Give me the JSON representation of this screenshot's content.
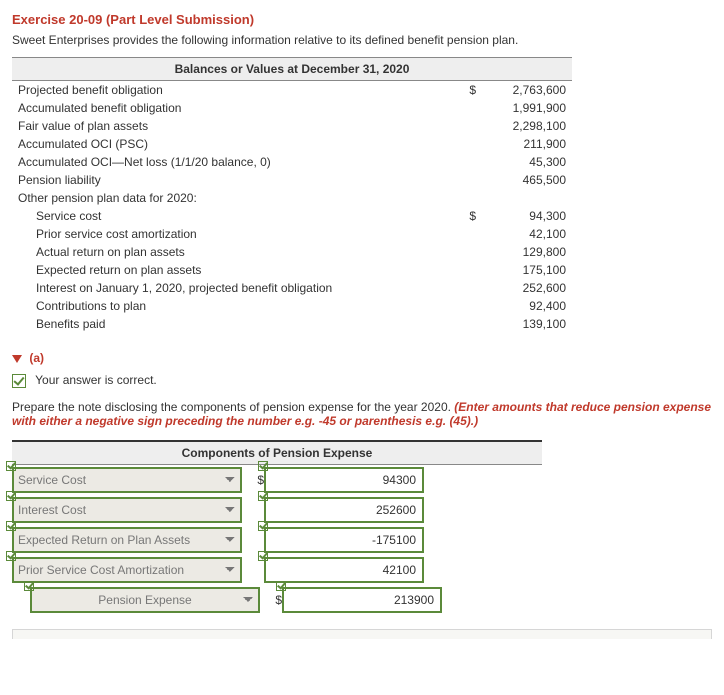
{
  "exercise": {
    "title": "Exercise 20-09 (Part Level Submission)",
    "intro": "Sweet Enterprises provides the following information relative to its defined benefit pension plan."
  },
  "balances": {
    "header": "Balances or Values at December 31, 2020",
    "rows": [
      {
        "label": "Projected benefit obligation",
        "currency": "$",
        "value": "2,763,600",
        "indent": false
      },
      {
        "label": "Accumulated benefit obligation",
        "currency": "",
        "value": "1,991,900",
        "indent": false
      },
      {
        "label": "Fair value of plan assets",
        "currency": "",
        "value": "2,298,100",
        "indent": false
      },
      {
        "label": "Accumulated OCI (PSC)",
        "currency": "",
        "value": "211,900",
        "indent": false
      },
      {
        "label": "Accumulated OCI—Net loss (1/1/20 balance, 0)",
        "currency": "",
        "value": "45,300",
        "indent": false
      },
      {
        "label": "Pension liability",
        "currency": "",
        "value": "465,500",
        "indent": false
      },
      {
        "label": "Other pension plan data for 2020:",
        "currency": "",
        "value": "",
        "indent": false
      },
      {
        "label": "Service cost",
        "currency": "$",
        "value": "94,300",
        "indent": true
      },
      {
        "label": "Prior service cost amortization",
        "currency": "",
        "value": "42,100",
        "indent": true
      },
      {
        "label": "Actual return on plan assets",
        "currency": "",
        "value": "129,800",
        "indent": true
      },
      {
        "label": "Expected return on plan assets",
        "currency": "",
        "value": "175,100",
        "indent": true
      },
      {
        "label": "Interest on January 1, 2020, projected benefit obligation",
        "currency": "",
        "value": "252,600",
        "indent": true
      },
      {
        "label": "Contributions to plan",
        "currency": "",
        "value": "92,400",
        "indent": true
      },
      {
        "label": "Benefits paid",
        "currency": "",
        "value": "139,100",
        "indent": true
      }
    ]
  },
  "part_a": {
    "label": "(a)",
    "correct_msg": "Your answer is correct.",
    "instruction_plain": "Prepare the note disclosing the components of pension expense for the year 2020. ",
    "instruction_red": "(Enter amounts that reduce pension expense with either a negative sign preceding the number e.g. -45 or parenthesis e.g. (45).)",
    "table_header": "Components of Pension Expense",
    "rows": [
      {
        "select": "Service Cost",
        "dollar": "$",
        "value": "94300",
        "total": false
      },
      {
        "select": "Interest Cost",
        "dollar": "",
        "value": "252600",
        "total": false
      },
      {
        "select": "Expected Return on Plan Assets",
        "dollar": "",
        "value": "-175100",
        "total": false
      },
      {
        "select": "Prior Service Cost Amortization",
        "dollar": "",
        "value": "42100",
        "total": false
      },
      {
        "select": "Pension Expense",
        "dollar": "$",
        "value": "213900",
        "total": true
      }
    ]
  }
}
